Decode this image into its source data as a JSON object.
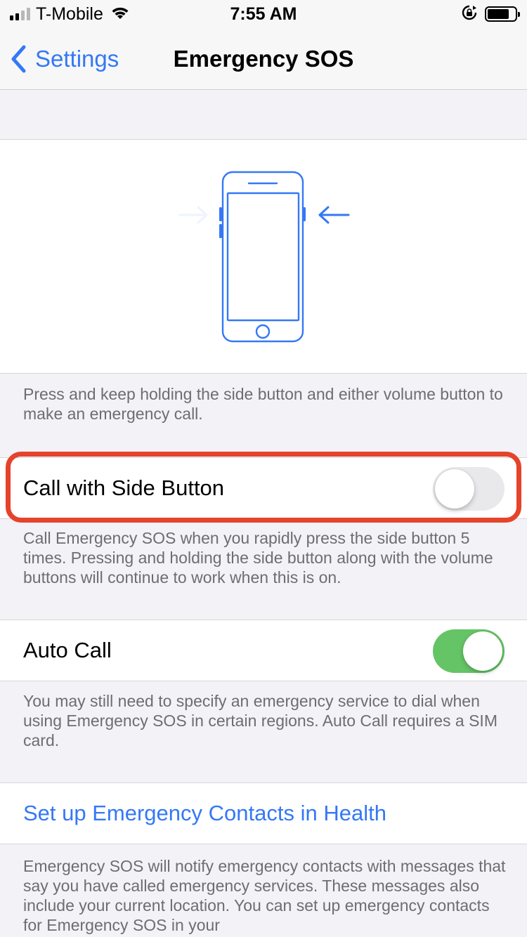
{
  "status_bar": {
    "carrier": "T-Mobile",
    "time": "7:55 AM",
    "signal_bars_filled": 2,
    "signal_bars_total": 4,
    "icons": [
      "signal-icon",
      "wifi-icon",
      "orientation-lock-icon",
      "battery-icon"
    ],
    "battery_level": 0.8
  },
  "nav": {
    "back_label": "Settings",
    "title": "Emergency SOS"
  },
  "illustration": {
    "icon": "iphone-side-button-press-illustration",
    "accent_color": "#3478f6",
    "faded_color": "#eef3fe"
  },
  "intro_footer": "Press and keep holding the side button and either volume button to make an emergency call.",
  "call_with_side_button": {
    "label": "Call with Side Button",
    "enabled": false,
    "highlighted": true,
    "highlight_color": "#e5432b",
    "footer": "Call Emergency SOS when you rapidly press the side button 5 times. Pressing and holding the side button along with the volume buttons will continue to work when this is on."
  },
  "auto_call": {
    "label": "Auto Call",
    "enabled": true,
    "on_color": "#65c466",
    "footer": "You may still need to specify an emergency service to dial when using Emergency SOS in certain regions. Auto Call requires a SIM card."
  },
  "emergency_contacts": {
    "link_label": "Set up Emergency Contacts in Health",
    "footer": "Emergency SOS will notify emergency contacts with messages that say you have called emergency services. These messages also include your current location. You can set up emergency contacts for Emergency SOS in your"
  }
}
